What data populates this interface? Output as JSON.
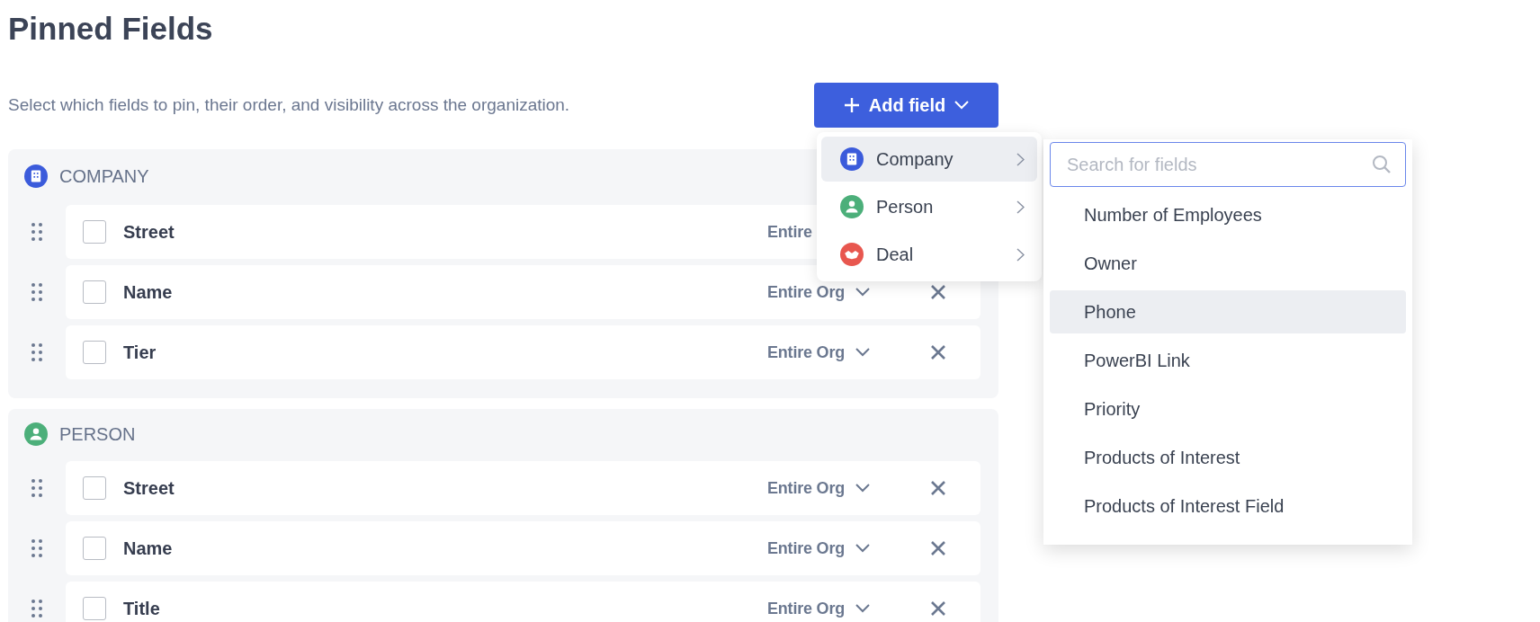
{
  "title": "Pinned Fields",
  "description": "Select which fields to pin, their order, and visibility across the organization.",
  "add_button": {
    "label": "Add field"
  },
  "sections": [
    {
      "kind": "company",
      "label": "COMPANY",
      "color": "#3b5bdb",
      "rows": [
        {
          "kind": "covered",
          "name": "Street",
          "checked": false,
          "visibility": "Entire"
        },
        {
          "kind": "full",
          "name": "Name",
          "checked": false,
          "visibility": "Entire Org"
        },
        {
          "kind": "full",
          "name": "Tier",
          "checked": false,
          "visibility": "Entire Org"
        }
      ]
    },
    {
      "kind": "person",
      "label": "PERSON",
      "color": "#4caf7a",
      "rows": [
        {
          "kind": "full",
          "name": "Street",
          "checked": false,
          "visibility": "Entire Org"
        },
        {
          "kind": "full",
          "name": "Name",
          "checked": false,
          "visibility": "Entire Org"
        },
        {
          "kind": "full",
          "name": "Title",
          "checked": false,
          "visibility": "Entire Org"
        }
      ]
    }
  ],
  "menu": {
    "items": [
      {
        "kind": "company",
        "label": "Company",
        "color": "#3b5bdb",
        "selected": true
      },
      {
        "kind": "person",
        "label": "Person",
        "color": "#4caf7a",
        "selected": false
      },
      {
        "kind": "deal",
        "label": "Deal",
        "color": "#e8574f",
        "selected": false
      }
    ]
  },
  "submenu": {
    "search": {
      "placeholder": "Search for fields"
    },
    "items": [
      {
        "label": "Number of Employees",
        "selected": false
      },
      {
        "label": "Owner",
        "selected": false
      },
      {
        "label": "Phone",
        "selected": true
      },
      {
        "label": "PowerBI Link",
        "selected": false
      },
      {
        "label": "Priority",
        "selected": false
      },
      {
        "label": "Products of Interest",
        "selected": false
      },
      {
        "label": "Products of Interest Field",
        "selected": false
      }
    ]
  }
}
